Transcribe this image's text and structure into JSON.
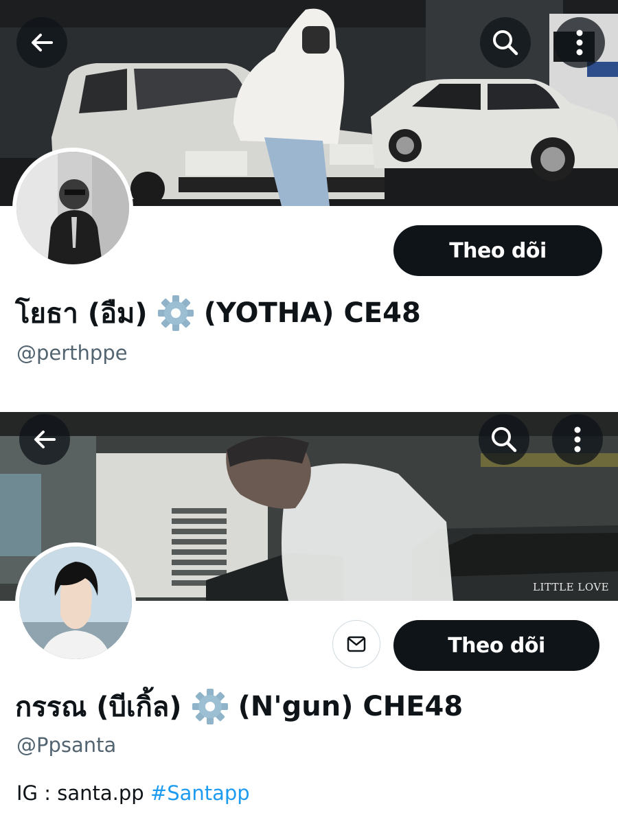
{
  "profiles": [
    {
      "display_name": "โยธา (อืม)",
      "display_name_suffix": "(YOTHA) CE48",
      "badge_icon": "gear-emoji-icon",
      "handle": "@perthppe",
      "follow_label": "Theo dõi",
      "icons": [
        "back-arrow-icon",
        "search-icon",
        "more-vertical-icon"
      ]
    },
    {
      "display_name": "กรรณ (บีเกิ้ล)",
      "display_name_suffix": "(N'gun) CHE48",
      "badge_icon": "gear-emoji-icon",
      "handle": "@Ppsanta",
      "follow_label": "Theo dõi",
      "message_icon": "envelope-icon",
      "bio_prefix": "IG : santa.pp",
      "bio_hashtag": "#Santapp",
      "banner_watermark": "LITTLE LOVE",
      "icons": [
        "back-arrow-icon",
        "search-icon",
        "more-vertical-icon"
      ]
    }
  ],
  "colors": {
    "button_dark": "#0f1419",
    "handle_gray": "#536471",
    "hashtag_blue": "#1d9bf0",
    "border_light": "#cfd9de"
  }
}
